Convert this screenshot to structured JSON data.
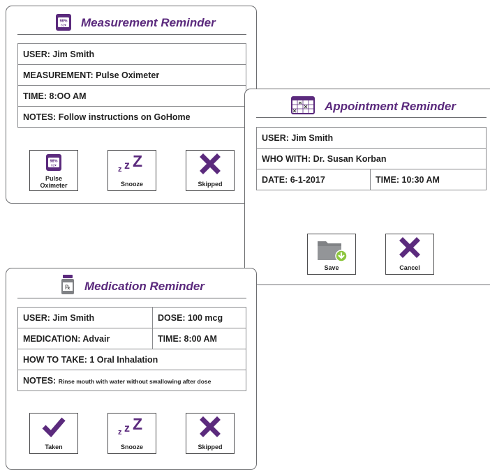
{
  "measurement": {
    "title": "Measurement Reminder",
    "rows": [
      "USER: Jim Smith",
      "MEASUREMENT: Pulse Oximeter",
      "TIME:  8:OO AM",
      "NOTES:  Follow instructions on GoHome"
    ],
    "icon_text_top": "98%",
    "icon_text_bottom": "82♥",
    "buttons": {
      "pulse_line1": "Pulse",
      "pulse_line2": "Oximeter",
      "snooze": "Snooze",
      "skipped": "Skipped"
    },
    "icons": [
      "pulse-oximeter-icon",
      "snooze-icon",
      "x-icon"
    ]
  },
  "appointment": {
    "title": "Appointment Reminder",
    "user": "USER:  Jim Smith",
    "who_with": "WHO WITH: Dr. Susan Korban",
    "date": "DATE: 6-1-2017",
    "time": "TIME:  10:30 AM",
    "buttons": {
      "save": "Save",
      "cancel": "Cancel"
    },
    "icons": [
      "calendar-icon",
      "folder-save-icon",
      "x-icon"
    ]
  },
  "medication": {
    "title": "Medication Reminder",
    "user": "USER:  Jim Smith",
    "dose": "DOSE: 100 mcg",
    "medication": "MEDICATION:  Advair",
    "time": "TIME: 8:00 AM",
    "how_to_take": "HOW TO TAKE:  1 Oral Inhalation",
    "notes_label": "NOTES:",
    "notes_text": "Rinse mouth with water without swallowing after dose",
    "buttons": {
      "taken": "Taken",
      "snooze": "Snooze",
      "skipped": "Skipped"
    },
    "icons": [
      "pill-bottle-icon",
      "checkmark-icon",
      "snooze-icon",
      "x-icon"
    ]
  },
  "colors": {
    "accent": "#5b2a7d",
    "border": "#6d6e71",
    "icon_gray": "#808285",
    "green": "#8dc63f"
  }
}
